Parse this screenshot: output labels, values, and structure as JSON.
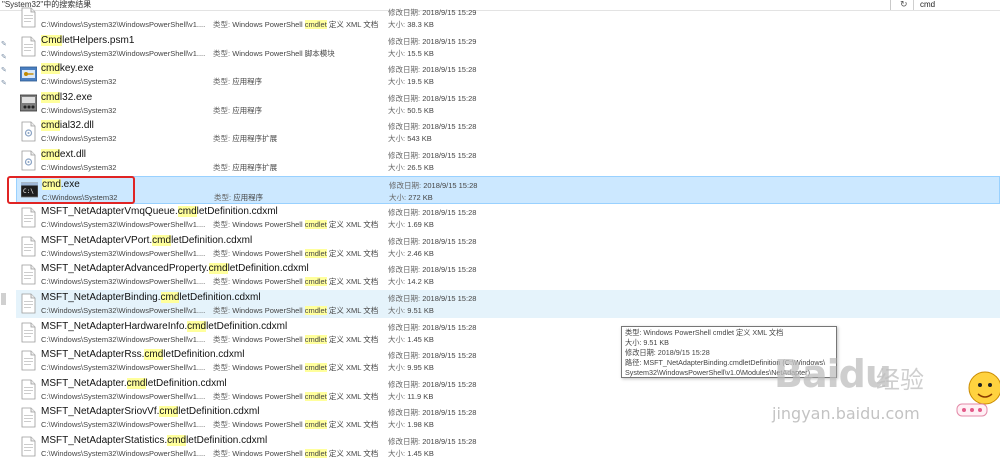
{
  "topbar": {
    "breadcrumb": "\"System32\"中的搜索结果",
    "refresh_glyph": "↻",
    "search_value": "cmd"
  },
  "labels": {
    "type": "类型:",
    "modified": "修改日期:",
    "size": "大小:"
  },
  "rows": [
    {
      "pre": "",
      "hl": "",
      "post": "",
      "path": "C:\\Windows\\System32\\WindowsPowerShell\\v1....",
      "type_pre": "Windows PowerShell ",
      "type_hl": "cmdlet",
      "type_post": " 定义 XML 文档",
      "date": "2018/9/15 15:29",
      "size": "38.3 KB",
      "icon": "xml-document-icon"
    },
    {
      "pre": "",
      "hl": "Cmd",
      "post": "letHelpers.psm1",
      "path": "C:\\Windows\\System32\\WindowsPowerShell\\v1....",
      "type_pre": "Windows PowerShell 脚本模块",
      "type_hl": "",
      "type_post": "",
      "date": "2018/9/15 15:29",
      "size": "15.5 KB",
      "icon": "document-icon"
    },
    {
      "pre": "",
      "hl": "cmd",
      "post": "key.exe",
      "path": "C:\\Windows\\System32",
      "type_pre": "应用程序",
      "type_hl": "",
      "type_post": "",
      "date": "2018/9/15 15:28",
      "size": "19.5 KB",
      "icon": "key-app-icon"
    },
    {
      "pre": "",
      "hl": "cmd",
      "post": "l32.exe",
      "path": "C:\\Windows\\System32",
      "type_pre": "应用程序",
      "type_hl": "",
      "type_post": "",
      "date": "2018/9/15 15:28",
      "size": "50.5 KB",
      "icon": "dial-app-icon"
    },
    {
      "pre": "",
      "hl": "cmd",
      "post": "ial32.dll",
      "path": "C:\\Windows\\System32",
      "type_pre": "应用程序扩展",
      "type_hl": "",
      "type_post": "",
      "date": "2018/9/15 15:28",
      "size": "543 KB",
      "icon": "dll-file-icon"
    },
    {
      "pre": "",
      "hl": "cmd",
      "post": "ext.dll",
      "path": "C:\\Windows\\System32",
      "type_pre": "应用程序扩展",
      "type_hl": "",
      "type_post": "",
      "date": "2018/9/15 15:28",
      "size": "26.5 KB",
      "icon": "dll-file-icon"
    },
    {
      "pre": "",
      "hl": "cmd",
      "post": ".exe",
      "path": "C:\\Windows\\System32",
      "type_pre": "应用程序",
      "type_hl": "",
      "type_post": "",
      "date": "2018/9/15 15:28",
      "size": "272 KB",
      "icon": "command-prompt-icon"
    },
    {
      "pre": "MSFT_NetAdapterVmqQueue.",
      "hl": "cmd",
      "post": "letDefinition.cdxml",
      "path": "C:\\Windows\\System32\\WindowsPowerShell\\v1....",
      "type_pre": "Windows PowerShell ",
      "type_hl": "cmdlet",
      "type_post": " 定义 XML 文档",
      "date": "2018/9/15 15:28",
      "size": "1.69 KB",
      "icon": "xml-document-icon"
    },
    {
      "pre": "MSFT_NetAdapterVPort.",
      "hl": "cmd",
      "post": "letDefinition.cdxml",
      "path": "C:\\Windows\\System32\\WindowsPowerShell\\v1....",
      "type_pre": "Windows PowerShell ",
      "type_hl": "cmdlet",
      "type_post": " 定义 XML 文档",
      "date": "2018/9/15 15:28",
      "size": "2.46 KB",
      "icon": "xml-document-icon"
    },
    {
      "pre": "MSFT_NetAdapterAdvancedProperty.",
      "hl": "cmd",
      "post": "letDefinition.cdxml",
      "path": "C:\\Windows\\System32\\WindowsPowerShell\\v1....",
      "type_pre": "Windows PowerShell ",
      "type_hl": "cmdlet",
      "type_post": " 定义 XML 文档",
      "date": "2018/9/15 15:28",
      "size": "14.2 KB",
      "icon": "xml-document-icon"
    },
    {
      "pre": "MSFT_NetAdapterBinding.",
      "hl": "cmd",
      "post": "letDefinition.cdxml",
      "path": "C:\\Windows\\System32\\WindowsPowerShell\\v1....",
      "type_pre": "Windows PowerShell ",
      "type_hl": "cmdlet",
      "type_post": " 定义 XML 文档",
      "date": "2018/9/15 15:28",
      "size": "9.51 KB",
      "icon": "xml-document-icon"
    },
    {
      "pre": "MSFT_NetAdapterHardwareInfo.",
      "hl": "cmd",
      "post": "letDefinition.cdxml",
      "path": "C:\\Windows\\System32\\WindowsPowerShell\\v1....",
      "type_pre": "Windows PowerShell ",
      "type_hl": "cmdlet",
      "type_post": " 定义 XML 文档",
      "date": "2018/9/15 15:28",
      "size": "1.45 KB",
      "icon": "xml-document-icon"
    },
    {
      "pre": "MSFT_NetAdapterRss.",
      "hl": "cmd",
      "post": "letDefinition.cdxml",
      "path": "C:\\Windows\\System32\\WindowsPowerShell\\v1....",
      "type_pre": "Windows PowerShell ",
      "type_hl": "cmdlet",
      "type_post": " 定义 XML 文档",
      "date": "2018/9/15 15:28",
      "size": "9.95 KB",
      "icon": "xml-document-icon"
    },
    {
      "pre": "MSFT_NetAdapter.",
      "hl": "cmd",
      "post": "letDefinition.cdxml",
      "path": "C:\\Windows\\System32\\WindowsPowerShell\\v1....",
      "type_pre": "Windows PowerShell ",
      "type_hl": "cmdlet",
      "type_post": " 定义 XML 文档",
      "date": "2018/9/15 15:28",
      "size": "11.9 KB",
      "icon": "xml-document-icon"
    },
    {
      "pre": "MSFT_NetAdapterSriovVf.",
      "hl": "cmd",
      "post": "letDefinition.cdxml",
      "path": "C:\\Windows\\System32\\WindowsPowerShell\\v1....",
      "type_pre": "Windows PowerShell ",
      "type_hl": "cmdlet",
      "type_post": " 定义 XML 文档",
      "date": "2018/9/15 15:28",
      "size": "1.98 KB",
      "icon": "xml-document-icon"
    },
    {
      "pre": "MSFT_NetAdapterStatistics.",
      "hl": "cmd",
      "post": "letDefinition.cdxml",
      "path": "C:\\Windows\\System32\\WindowsPowerShell\\v1....",
      "type_pre": "Windows PowerShell ",
      "type_hl": "cmdlet",
      "type_post": " 定义 XML 文档",
      "date": "2018/9/15 15:28",
      "size": "1.45 KB",
      "icon": "xml-document-icon"
    }
  ],
  "selected_index": 6,
  "hover_index": 10,
  "tooltip": {
    "line1": "类型: Windows PowerShell cmdlet 定义 XML 文档",
    "line2": "大小: 9.51 KB",
    "line3": "修改日期: 2018/9/15 15:28",
    "line4": "路径: MSFT_NetAdapterBinding.cmdletDefinition (C:\\Windows\\",
    "line5": "System32\\WindowsPowerShell\\v1.0\\Modules\\NetAdapter)"
  },
  "watermark": {
    "brand": "Baidu",
    "cn": "经验",
    "url": "jingyan.baidu.com"
  },
  "colors": {
    "highlight": "#ffff9c",
    "selected_bg": "#cce8ff",
    "hover_bg": "#e5f3fb",
    "annotation": "#e02424"
  }
}
